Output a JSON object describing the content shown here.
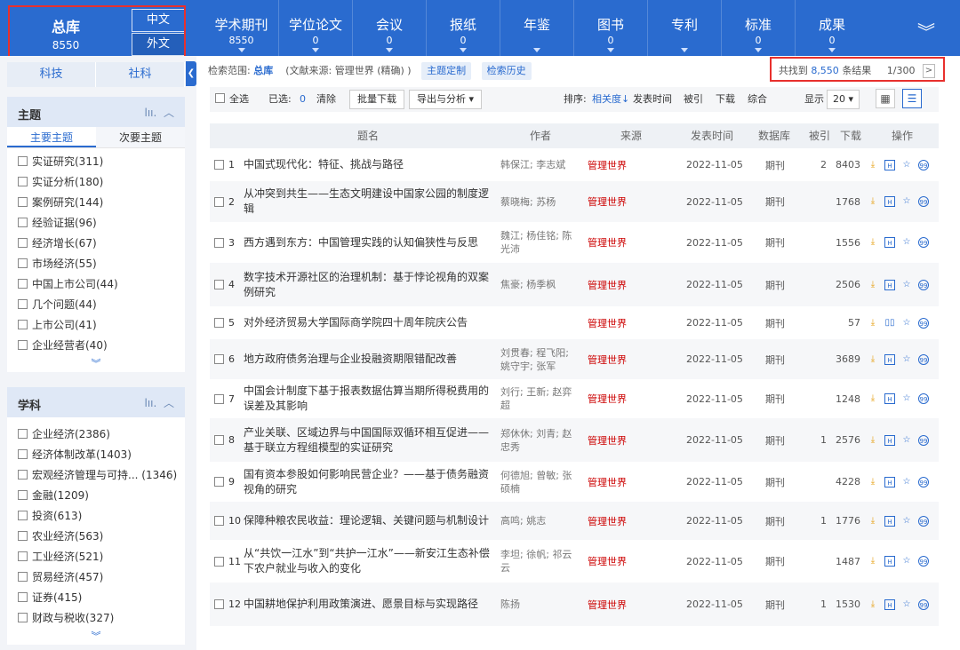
{
  "header": {
    "zongku_label": "总库",
    "zongku_count": "8550",
    "lang_zh": "中文",
    "lang_foreign": "外文",
    "tabs": [
      {
        "label": "学术期刊",
        "count": "8550"
      },
      {
        "label": "学位论文",
        "count": "0"
      },
      {
        "label": "会议",
        "count": "0"
      },
      {
        "label": "报纸",
        "count": "0"
      },
      {
        "label": "年鉴",
        "count": ""
      },
      {
        "label": "图书",
        "count": "0"
      },
      {
        "label": "专利",
        "count": ""
      },
      {
        "label": "标准",
        "count": "0"
      },
      {
        "label": "成果",
        "count": "0"
      }
    ],
    "more_icon": "chevron-double-down-icon"
  },
  "sidebar": {
    "tabs": [
      "科技",
      "社科"
    ],
    "topic": {
      "title": "主题",
      "subtabs": [
        "主要主题",
        "次要主题"
      ],
      "items": [
        "实证研究(311)",
        "实证分析(180)",
        "案例研究(144)",
        "经验证据(96)",
        "经济增长(67)",
        "市场经济(55)",
        "中国上市公司(44)",
        "几个问题(44)",
        "上市公司(41)",
        "企业经营者(40)"
      ]
    },
    "subject": {
      "title": "学科",
      "items": [
        "企业经济(2386)",
        "经济体制改革(1403)",
        "宏观经济管理与可持... (1346)",
        "金融(1209)",
        "投资(613)",
        "农业经济(563)",
        "工业经济(521)",
        "贸易经济(457)",
        "证券(415)",
        "财政与税收(327)"
      ]
    }
  },
  "scope": {
    "label": "检索范围:",
    "value": "总库",
    "source": "(文献来源: 管理世界 (精确) )",
    "btn_subscribe": "主题定制",
    "btn_history": "检索历史"
  },
  "result": {
    "prefix": "共找到",
    "count": "8,550",
    "suffix": "条结果",
    "page": "1/300",
    "next": ">"
  },
  "toolbar": {
    "select_all": "全选",
    "selected_label": "已选:",
    "selected_count": "0",
    "clear": "清除",
    "batch_download": "批量下载",
    "export": "导出与分析 ▾",
    "sort_label": "排序:",
    "sort_relevance": "相关度",
    "sort_date": "发表时间",
    "sort_cite": "被引",
    "sort_download": "下载",
    "sort_composite": "综合",
    "display_label": "显示",
    "page_size": "20 ▾"
  },
  "table": {
    "headers": {
      "title": "题名",
      "author": "作者",
      "source": "来源",
      "date": "发表时间",
      "db": "数据库",
      "cite": "被引",
      "download": "下载",
      "ops": "操作"
    },
    "rows": [
      {
        "no": "1",
        "title": "中国式现代化：特征、挑战与路径",
        "author": "韩保江; 李志斌",
        "source": "管理世界",
        "date": "2022-11-05",
        "db": "期刊",
        "cite": "2",
        "download": "8403",
        "html": true
      },
      {
        "no": "2",
        "title": "从冲突到共生——生态文明建设中国家公园的制度逻辑",
        "author": "蔡晓梅; 苏杨",
        "source": "管理世界",
        "date": "2022-11-05",
        "db": "期刊",
        "cite": "",
        "download": "1768",
        "html": true
      },
      {
        "no": "3",
        "title": "西方遇到东方：中国管理实践的认知偏狭性与反思",
        "author": "魏江; 杨佳铭; 陈光沛",
        "source": "管理世界",
        "date": "2022-11-05",
        "db": "期刊",
        "cite": "",
        "download": "1556",
        "html": true
      },
      {
        "no": "4",
        "title": "数字技术开源社区的治理机制：基于悖论视角的双案例研究",
        "author": "焦豪; 杨季枫",
        "source": "管理世界",
        "date": "2022-11-05",
        "db": "期刊",
        "cite": "",
        "download": "2506",
        "html": true
      },
      {
        "no": "5",
        "title": "对外经济贸易大学国际商学院四十周年院庆公告",
        "author": "",
        "source": "管理世界",
        "date": "2022-11-05",
        "db": "期刊",
        "cite": "",
        "download": "57",
        "html": false
      },
      {
        "no": "6",
        "title": "地方政府债务治理与企业投融资期限错配改善",
        "author": "刘贯春; 程飞阳; 姚守宇; 张军",
        "source": "管理世界",
        "date": "2022-11-05",
        "db": "期刊",
        "cite": "",
        "download": "3689",
        "html": true
      },
      {
        "no": "7",
        "title": "中国会计制度下基于报表数据估算当期所得税费用的误差及其影响",
        "author": "刘行; 王新; 赵弈超",
        "source": "管理世界",
        "date": "2022-11-05",
        "db": "期刊",
        "cite": "",
        "download": "1248",
        "html": true
      },
      {
        "no": "8",
        "title": "产业关联、区域边界与中国国际双循环相互促进——基于联立方程组模型的实证研究",
        "author": "郑休休; 刘青; 赵忠秀",
        "source": "管理世界",
        "date": "2022-11-05",
        "db": "期刊",
        "cite": "1",
        "download": "2576",
        "html": true
      },
      {
        "no": "9",
        "title": "国有资本参股如何影响民营企业？——基于债务融资视角的研究",
        "author": "何德旭; 曾敏; 张硕楠",
        "source": "管理世界",
        "date": "2022-11-05",
        "db": "期刊",
        "cite": "",
        "download": "4228",
        "html": true
      },
      {
        "no": "10",
        "title": "保障种粮农民收益：理论逻辑、关键问题与机制设计",
        "author": "高鸣; 姚志",
        "source": "管理世界",
        "date": "2022-11-05",
        "db": "期刊",
        "cite": "1",
        "download": "1776",
        "html": true
      },
      {
        "no": "11",
        "title": "从“共饮一江水”到“共护一江水”——新安江生态补偿下农户就业与收入的变化",
        "author": "李坦; 徐帆; 祁云云",
        "source": "管理世界",
        "date": "2022-11-05",
        "db": "期刊",
        "cite": "",
        "download": "1487",
        "html": true
      },
      {
        "no": "12",
        "title": "中国耕地保护利用政策演进、愿景目标与实现路径",
        "author": "陈扬",
        "source": "管理世界",
        "date": "2022-11-05",
        "db": "期刊",
        "cite": "1",
        "download": "1530",
        "html": true
      }
    ]
  },
  "colors": {
    "brand": "#2a6bcf",
    "source_red": "#cc0000",
    "highlight_box": "#e8302d",
    "download_icon": "#e6a012"
  }
}
